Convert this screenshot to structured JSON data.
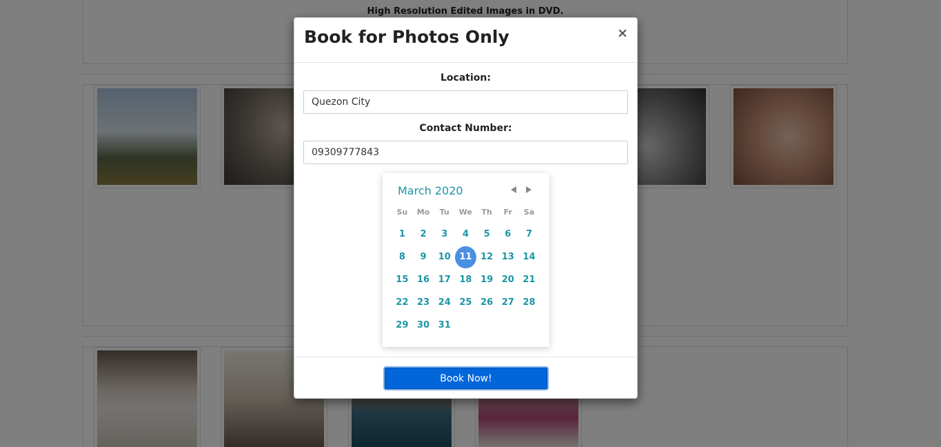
{
  "background": {
    "caption": "High Resolution Edited Images in DVD."
  },
  "modal": {
    "title": "Book for Photos Only",
    "close_label": "×",
    "location_label": "Location:",
    "location_value": "Quezon City",
    "contact_label": "Contact Number:",
    "contact_value": "09309777843",
    "submit_label": "Book Now!"
  },
  "datepicker": {
    "month_title": "March 2020",
    "weekdays": [
      "Su",
      "Mo",
      "Tu",
      "We",
      "Th",
      "Fr",
      "Sa"
    ],
    "days": [
      1,
      2,
      3,
      4,
      5,
      6,
      7,
      8,
      9,
      10,
      11,
      12,
      13,
      14,
      15,
      16,
      17,
      18,
      19,
      20,
      21,
      22,
      23,
      24,
      25,
      26,
      27,
      28,
      29,
      30,
      31
    ],
    "selected_day": 11,
    "prev_icon": "triangle-left",
    "next_icon": "triangle-right"
  },
  "colors": {
    "accent": "#1b95a6",
    "selected": "#4a90e2",
    "button": "#0066d9"
  }
}
